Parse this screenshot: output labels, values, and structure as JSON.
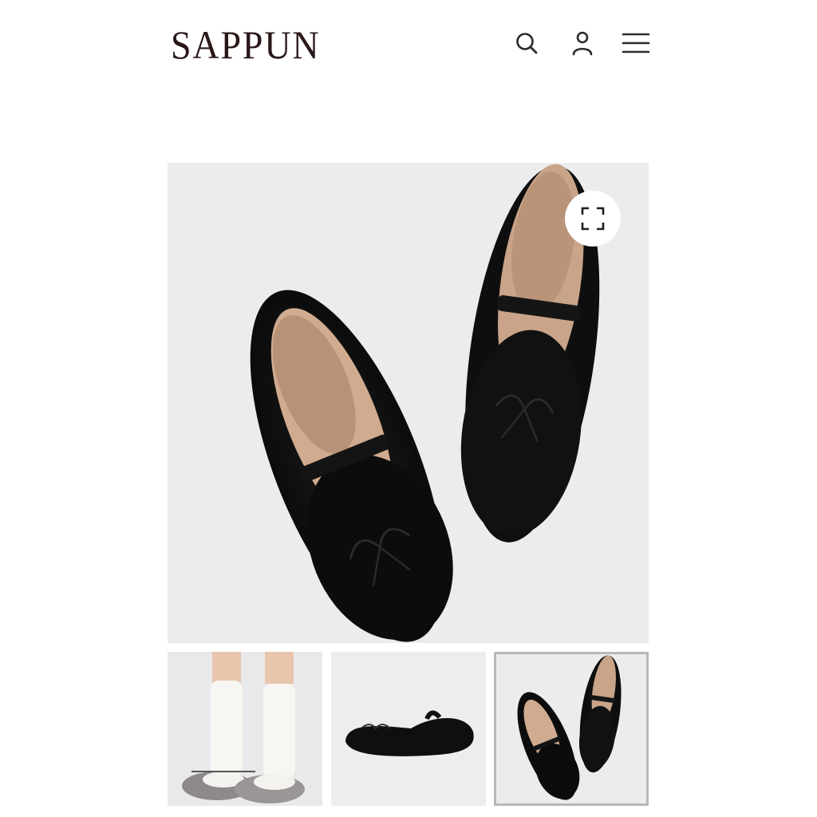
{
  "header": {
    "logo_text": "SAPPUN",
    "icons": [
      "search-icon",
      "account-icon",
      "menu-icon"
    ]
  },
  "gallery": {
    "main_image": "black-suede-ballet-flats-top-view",
    "expand_icon": "expand-icon",
    "thumbnails": [
      "model-wearing-silver-flats-with-white-socks",
      "black-flat-side-view",
      "black-suede-ballet-flats-top-view"
    ],
    "selected_thumbnail": 3
  },
  "colors": {
    "logo": "#2a1718",
    "image_background": "#ececef",
    "shoe": "#111111",
    "selected_border": "#b8b8bc"
  }
}
